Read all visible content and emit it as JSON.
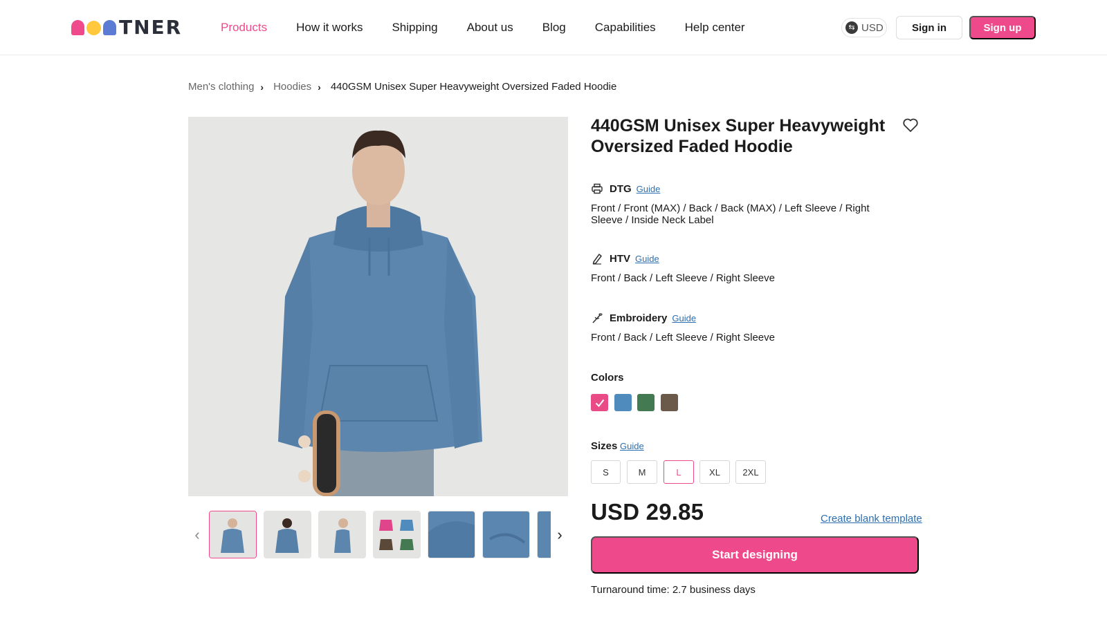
{
  "header": {
    "logo_text": "TNER",
    "nav": [
      "Products",
      "How it works",
      "Shipping",
      "About us",
      "Blog",
      "Capabilities",
      "Help center"
    ],
    "active_nav": "Products",
    "currency": "USD",
    "sign_in": "Sign in",
    "sign_up": "Sign up",
    "accent_color": "#ee4a8b"
  },
  "breadcrumb": {
    "items": [
      "Men's clothing",
      "Hoodies"
    ],
    "current": "440GSM Unisex Super Heavyweight Oversized Faded Hoodie"
  },
  "product": {
    "title": "440GSM Unisex Super Heavyweight Oversized Faded Hoodie",
    "methods": [
      {
        "name": "DTG",
        "guide": "Guide",
        "icon": "printer-icon",
        "placements": "Front / Front (MAX) / Back / Back (MAX) / Left Sleeve / Right Sleeve / Inside Neck Label"
      },
      {
        "name": "HTV",
        "guide": "Guide",
        "icon": "pen-icon",
        "placements": "Front / Back / Left Sleeve / Right Sleeve"
      },
      {
        "name": "Embroidery",
        "guide": "Guide",
        "icon": "needle-icon",
        "placements": "Front / Back / Left Sleeve / Right Sleeve"
      }
    ],
    "colors_label": "Colors",
    "colors": [
      "#e94b86",
      "#4f8bbd",
      "#447a52",
      "#6b5a4a"
    ],
    "selected_color_index": 0,
    "sizes_label": "Sizes",
    "sizes_guide": "Guide",
    "sizes": [
      "S",
      "M",
      "L",
      "XL",
      "2XL"
    ],
    "selected_size": "L",
    "price": "USD 29.85",
    "create_blank_template": "Create blank template",
    "start_designing": "Start designing",
    "turnaround": "Turnaround time: 2.7 business days"
  },
  "gallery": {
    "thumbnails": [
      "front-view",
      "back-view",
      "side-view",
      "color-variants",
      "hood-detail",
      "cuff-detail",
      "fabric-detail"
    ],
    "selected_index": 0
  }
}
